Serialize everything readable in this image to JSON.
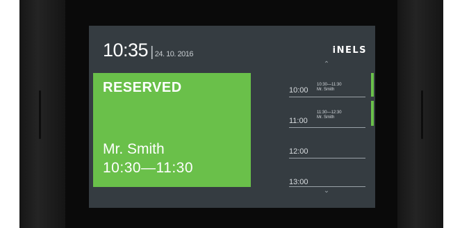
{
  "header": {
    "time": "10:35",
    "separator": "|",
    "date": "24. 10. 2016",
    "logo": "iNELS"
  },
  "status": {
    "title": "RESERVED",
    "guest": "Mr. Smith",
    "range": "10:30—11:30",
    "color": "#6ac04a"
  },
  "schedule": {
    "scroll_up_icon": "chevron-up-icon",
    "scroll_down_icon": "chevron-down-icon",
    "slots": [
      {
        "time": "10:00",
        "booking_range": "10:30—11:30",
        "booking_name": "Mr. Smith",
        "reserved": true
      },
      {
        "time": "11:00",
        "booking_range": "11:30—12:30",
        "booking_name": "Mr. Smith",
        "reserved": true
      },
      {
        "time": "12:00",
        "booking_range": "",
        "booking_name": "",
        "reserved": false
      },
      {
        "time": "13:00",
        "booking_range": "",
        "booking_name": "",
        "reserved": false
      }
    ]
  }
}
